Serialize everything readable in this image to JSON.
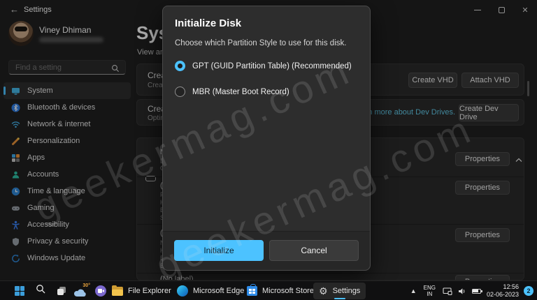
{
  "colors": {
    "accent": "#4cc2ff",
    "dialog_bg": "#2d2d2d",
    "window_bg": "#202020",
    "taskbar_bg": "#101011"
  },
  "watermark": {
    "text": "geekermag.com"
  },
  "titlebar": {
    "title": "Settings"
  },
  "sidebar": {
    "user": {
      "name": "Viney Dhiman"
    },
    "search_placeholder": "Find a setting",
    "items": [
      {
        "label": "System",
        "selected": true
      },
      {
        "label": "Bluetooth & devices",
        "selected": false
      },
      {
        "label": "Network & internet",
        "selected": false
      },
      {
        "label": "Personalization",
        "selected": false
      },
      {
        "label": "Apps",
        "selected": false
      },
      {
        "label": "Accounts",
        "selected": false
      },
      {
        "label": "Time & language",
        "selected": false
      },
      {
        "label": "Gaming",
        "selected": false
      },
      {
        "label": "Accessibility",
        "selected": false
      },
      {
        "label": "Privacy & security",
        "selected": false
      },
      {
        "label": "Windows Update",
        "selected": false
      }
    ]
  },
  "main": {
    "heading": "System",
    "subtitle_fragment": "View and m",
    "vhd_card": {
      "title_fragment": "Create a",
      "subtitle_fragment": "Create an",
      "create_vhd_button": "Create VHD",
      "attach_vhd_button": "Attach VHD"
    },
    "devdrive_card": {
      "title_fragment": "Create a",
      "subtitle_fragment": "Optimize",
      "link": "Learn more about Dev Drives.",
      "button": "Create Dev Drive"
    },
    "properties_label": "Properties",
    "disk_rows": [
      {
        "lines": [
          "M",
          "D",
          "O"
        ]
      },
      {
        "lines": [
          "(",
          "F",
          "H",
          "B",
          "S"
        ]
      },
      {
        "lines": [
          "(",
          "N",
          "H",
          "B",
          "B"
        ]
      }
    ],
    "no_label_row": "(No label)"
  },
  "dialog": {
    "title": "Initialize Disk",
    "body": "Choose which Partition Style to use for this disk.",
    "options": [
      {
        "label": "GPT (GUID Partition Table) (Recommended)",
        "selected": true
      },
      {
        "label": "MBR (Master Boot Record)",
        "selected": false
      }
    ],
    "primary_button": "Initialize",
    "secondary_button": "Cancel"
  },
  "taskbar": {
    "weather_temp": "30°",
    "apps": [
      {
        "label": "File Explorer"
      },
      {
        "label": "Microsoft Edge"
      },
      {
        "label": "Microsoft Store"
      },
      {
        "label": "Settings",
        "active": true
      }
    ],
    "tray": {
      "language_line1": "ENG",
      "language_line2": "IN",
      "time": "12:56",
      "date": "02-06-2023",
      "badge": "2"
    }
  }
}
